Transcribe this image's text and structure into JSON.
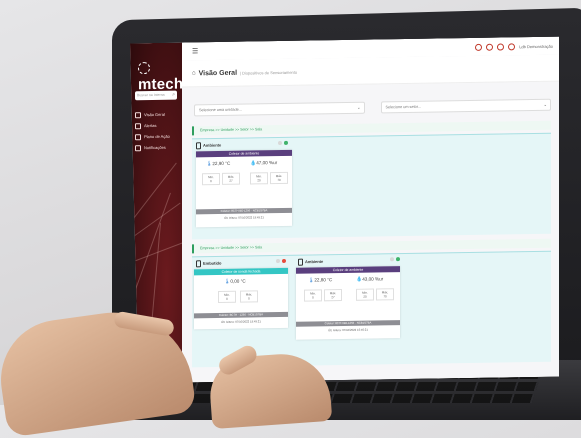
{
  "app": {
    "logo": "mtech",
    "search_placeholder": "Buscar na Interna",
    "user": "Ldb Demonstração"
  },
  "sidebar": {
    "items": [
      {
        "label": "Visão Geral",
        "icon": "home-icon"
      },
      {
        "label": "Alertas",
        "icon": "bell-icon"
      },
      {
        "label": "Plano de Ação",
        "icon": "clipboard-icon"
      },
      {
        "label": "Notificações",
        "icon": "bell-icon"
      }
    ]
  },
  "page": {
    "title": "Visão Geral",
    "subtitle": "| Dispositivos de Sensoriamento"
  },
  "filters": {
    "unit_placeholder": "Selecione uma unidade...",
    "sector_placeholder": "Selecione um setor..."
  },
  "sections": [
    {
      "breadcrumb": "Empresa >> Unidade >> Setor >> Sala",
      "devices": [
        {
          "name": "Ambiente",
          "header": "Coletor de ambiente",
          "temperature": "22,90 °C",
          "humidity": "47,00 %ur",
          "temp_min_label": "Min.",
          "temp_min": "0",
          "temp_max_label": "Máx.",
          "temp_max": "27",
          "hum_min_label": "Min.",
          "hum_min": "20",
          "hum_max_label": "Máx.",
          "hum_max": "70",
          "footer": "Coletor: 8CTH BE-1256 · NCB1S7BA",
          "last_read": "Últ. leitura: 07/10/2022 15:45:21",
          "status_colors": [
            "#d9d9d9",
            "#3fb36b"
          ]
        }
      ]
    },
    {
      "breadcrumb": "Empresa >> Unidade >> Setor >> Sala",
      "devices": [
        {
          "name": "Embutido",
          "header": "Coletor de sonda fechada",
          "temperature": "0,00 °C",
          "temp_min_label": "Min.",
          "temp_min": "0",
          "temp_max_label": "Máx.",
          "temp_max": "0",
          "footer": "Coletor: BCTH · 1256 · NCB1S7BA",
          "last_read": "Últ. leitura: 07/10/2022 15:45:21",
          "status_colors": [
            "#d9d9d9",
            "#e74c3c"
          ]
        },
        {
          "name": "Ambiente",
          "header": "Coletor de ambiente",
          "temperature": "22,80 °C",
          "humidity": "43,00 %ur",
          "temp_min_label": "Min.",
          "temp_min": "0",
          "temp_max_label": "Máx.",
          "temp_max": "27",
          "hum_min_label": "Min.",
          "hum_min": "20",
          "hum_max_label": "Máx.",
          "hum_max": "70",
          "footer": "Coletor: 8CTH BE-1256 · NCB1S7BA",
          "last_read": "Últ. leitura: 07/10/2022 15:45:21",
          "status_colors": [
            "#d9d9d9",
            "#3fb36b"
          ]
        }
      ]
    }
  ],
  "colors": {
    "sidebar": "#4a1215",
    "accent_teal": "#34c6c4",
    "card_header": "#5a3f7e",
    "breadcrumb_green": "#2f9e5e"
  }
}
